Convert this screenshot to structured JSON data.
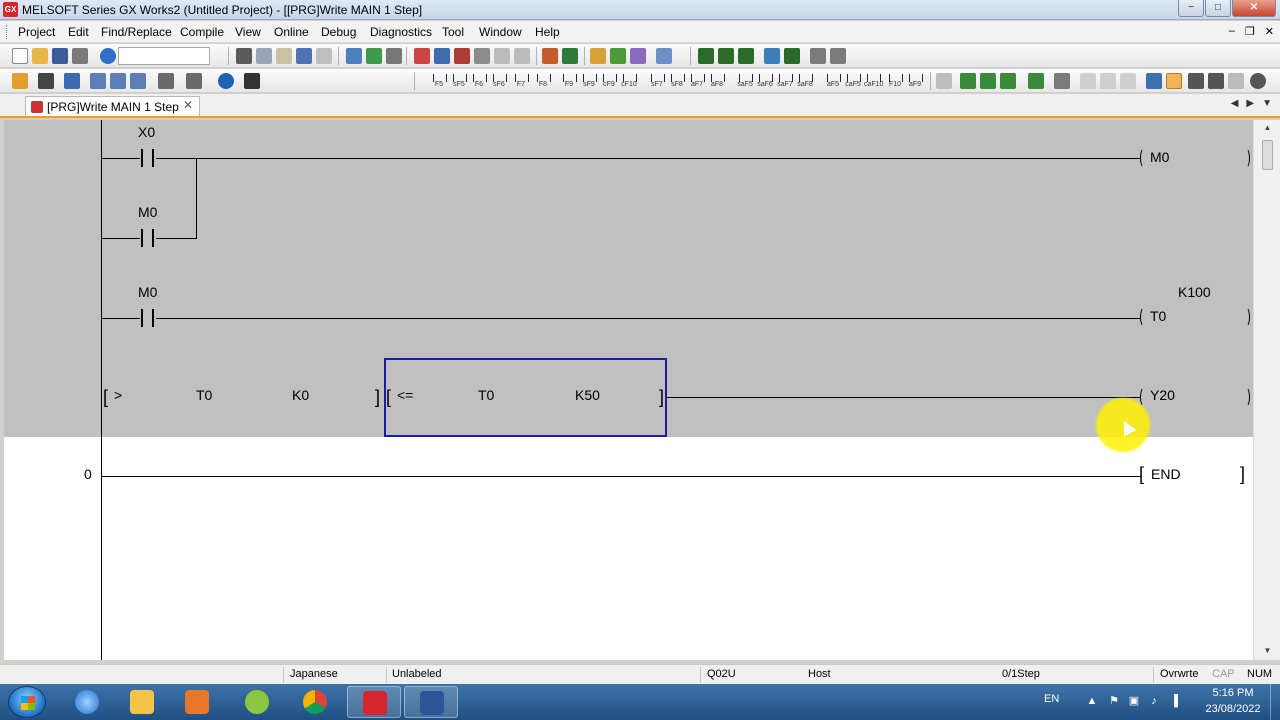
{
  "window": {
    "title": "MELSOFT Series GX Works2 (Untitled Project) - [[PRG]Write MAIN 1 Step]",
    "app_icon": "GX"
  },
  "menu": {
    "items": [
      "Project",
      "Edit",
      "Find/Replace",
      "Compile",
      "View",
      "Online",
      "Debug",
      "Diagnostics",
      "Tool",
      "Window",
      "Help"
    ]
  },
  "tab": {
    "label": "[PRG]Write MAIN 1 Step",
    "close": "✕"
  },
  "fkeys": [
    "F5",
    "sF5",
    "F6",
    "sF6",
    "F7",
    "F8",
    "F9",
    "sF9",
    "cF9",
    "cF10",
    "sF7",
    "sF8",
    "aF7",
    "aF8",
    "saF5",
    "saF6",
    "saF7",
    "saF8",
    "aF5",
    "caF5",
    "caF10",
    "F10",
    "aF9"
  ],
  "ladder": {
    "rungs": [
      {
        "contact1": "X0",
        "contact2": "M0",
        "coil": "M0"
      },
      {
        "contact": "M0",
        "coil": "T0",
        "setting": "K100"
      },
      {
        "compare1": {
          "op": ">",
          "a": "T0",
          "b": "K0"
        },
        "compare2": {
          "op": "<=",
          "a": "T0",
          "b": "K50"
        },
        "coil": "Y20"
      }
    ],
    "end": {
      "step": "0",
      "instruction": "END"
    }
  },
  "status": {
    "language": "Japanese",
    "label": "Unlabeled",
    "cpu": "Q02U",
    "connection": "Host",
    "steps": "0/1Step",
    "mode": "Ovrwrte",
    "caps": "CAP",
    "num": "NUM"
  },
  "taskbar": {
    "lang": "EN",
    "time": "5:16 PM",
    "date": "23/08/2022"
  },
  "colors": {
    "selection_bg": "#c0c0c0",
    "cursor": "#1c1c9c",
    "highlight": "#fff000",
    "tab_accent": "#f39b22"
  }
}
